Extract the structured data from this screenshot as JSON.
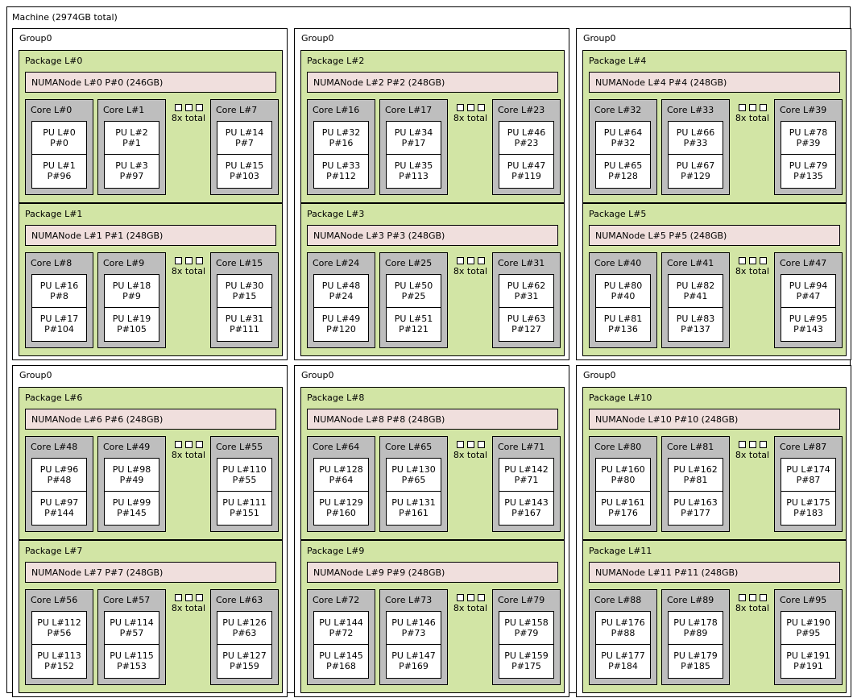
{
  "machine": {
    "label": "Machine (2974GB total)"
  },
  "groups": [
    {
      "label": "Group0",
      "packages": [
        {
          "label": "Package L#0",
          "numa": "NUMANode L#0 P#0 (246GB)",
          "more": "8x total",
          "cores": [
            {
              "label": "Core L#0",
              "pus": [
                {
                  "l": "PU L#0",
                  "p": "P#0"
                },
                {
                  "l": "PU L#1",
                  "p": "P#96"
                }
              ]
            },
            {
              "label": "Core L#1",
              "pus": [
                {
                  "l": "PU L#2",
                  "p": "P#1"
                },
                {
                  "l": "PU L#3",
                  "p": "P#97"
                }
              ]
            },
            {
              "label": "Core L#7",
              "pus": [
                {
                  "l": "PU L#14",
                  "p": "P#7"
                },
                {
                  "l": "PU L#15",
                  "p": "P#103"
                }
              ]
            }
          ]
        },
        {
          "label": "Package L#1",
          "numa": "NUMANode L#1 P#1 (248GB)",
          "more": "8x total",
          "cores": [
            {
              "label": "Core L#8",
              "pus": [
                {
                  "l": "PU L#16",
                  "p": "P#8"
                },
                {
                  "l": "PU L#17",
                  "p": "P#104"
                }
              ]
            },
            {
              "label": "Core L#9",
              "pus": [
                {
                  "l": "PU L#18",
                  "p": "P#9"
                },
                {
                  "l": "PU L#19",
                  "p": "P#105"
                }
              ]
            },
            {
              "label": "Core L#15",
              "pus": [
                {
                  "l": "PU L#30",
                  "p": "P#15"
                },
                {
                  "l": "PU L#31",
                  "p": "P#111"
                }
              ]
            }
          ]
        }
      ]
    },
    {
      "label": "Group0",
      "packages": [
        {
          "label": "Package L#2",
          "numa": "NUMANode L#2 P#2 (248GB)",
          "more": "8x total",
          "cores": [
            {
              "label": "Core L#16",
              "pus": [
                {
                  "l": "PU L#32",
                  "p": "P#16"
                },
                {
                  "l": "PU L#33",
                  "p": "P#112"
                }
              ]
            },
            {
              "label": "Core L#17",
              "pus": [
                {
                  "l": "PU L#34",
                  "p": "P#17"
                },
                {
                  "l": "PU L#35",
                  "p": "P#113"
                }
              ]
            },
            {
              "label": "Core L#23",
              "pus": [
                {
                  "l": "PU L#46",
                  "p": "P#23"
                },
                {
                  "l": "PU L#47",
                  "p": "P#119"
                }
              ]
            }
          ]
        },
        {
          "label": "Package L#3",
          "numa": "NUMANode L#3 P#3 (248GB)",
          "more": "8x total",
          "cores": [
            {
              "label": "Core L#24",
              "pus": [
                {
                  "l": "PU L#48",
                  "p": "P#24"
                },
                {
                  "l": "PU L#49",
                  "p": "P#120"
                }
              ]
            },
            {
              "label": "Core L#25",
              "pus": [
                {
                  "l": "PU L#50",
                  "p": "P#25"
                },
                {
                  "l": "PU L#51",
                  "p": "P#121"
                }
              ]
            },
            {
              "label": "Core L#31",
              "pus": [
                {
                  "l": "PU L#62",
                  "p": "P#31"
                },
                {
                  "l": "PU L#63",
                  "p": "P#127"
                }
              ]
            }
          ]
        }
      ]
    },
    {
      "label": "Group0",
      "packages": [
        {
          "label": "Package L#4",
          "numa": "NUMANode L#4 P#4 (248GB)",
          "more": "8x total",
          "cores": [
            {
              "label": "Core L#32",
              "pus": [
                {
                  "l": "PU L#64",
                  "p": "P#32"
                },
                {
                  "l": "PU L#65",
                  "p": "P#128"
                }
              ]
            },
            {
              "label": "Core L#33",
              "pus": [
                {
                  "l": "PU L#66",
                  "p": "P#33"
                },
                {
                  "l": "PU L#67",
                  "p": "P#129"
                }
              ]
            },
            {
              "label": "Core L#39",
              "pus": [
                {
                  "l": "PU L#78",
                  "p": "P#39"
                },
                {
                  "l": "PU L#79",
                  "p": "P#135"
                }
              ]
            }
          ]
        },
        {
          "label": "Package L#5",
          "numa": "NUMANode L#5 P#5 (248GB)",
          "more": "8x total",
          "cores": [
            {
              "label": "Core L#40",
              "pus": [
                {
                  "l": "PU L#80",
                  "p": "P#40"
                },
                {
                  "l": "PU L#81",
                  "p": "P#136"
                }
              ]
            },
            {
              "label": "Core L#41",
              "pus": [
                {
                  "l": "PU L#82",
                  "p": "P#41"
                },
                {
                  "l": "PU L#83",
                  "p": "P#137"
                }
              ]
            },
            {
              "label": "Core L#47",
              "pus": [
                {
                  "l": "PU L#94",
                  "p": "P#47"
                },
                {
                  "l": "PU L#95",
                  "p": "P#143"
                }
              ]
            }
          ]
        }
      ]
    },
    {
      "label": "Group0",
      "packages": [
        {
          "label": "Package L#6",
          "numa": "NUMANode L#6 P#6 (248GB)",
          "more": "8x total",
          "cores": [
            {
              "label": "Core L#48",
              "pus": [
                {
                  "l": "PU L#96",
                  "p": "P#48"
                },
                {
                  "l": "PU L#97",
                  "p": "P#144"
                }
              ]
            },
            {
              "label": "Core L#49",
              "pus": [
                {
                  "l": "PU L#98",
                  "p": "P#49"
                },
                {
                  "l": "PU L#99",
                  "p": "P#145"
                }
              ]
            },
            {
              "label": "Core L#55",
              "pus": [
                {
                  "l": "PU L#110",
                  "p": "P#55"
                },
                {
                  "l": "PU L#111",
                  "p": "P#151"
                }
              ]
            }
          ]
        },
        {
          "label": "Package L#7",
          "numa": "NUMANode L#7 P#7 (248GB)",
          "more": "8x total",
          "cores": [
            {
              "label": "Core L#56",
              "pus": [
                {
                  "l": "PU L#112",
                  "p": "P#56"
                },
                {
                  "l": "PU L#113",
                  "p": "P#152"
                }
              ]
            },
            {
              "label": "Core L#57",
              "pus": [
                {
                  "l": "PU L#114",
                  "p": "P#57"
                },
                {
                  "l": "PU L#115",
                  "p": "P#153"
                }
              ]
            },
            {
              "label": "Core L#63",
              "pus": [
                {
                  "l": "PU L#126",
                  "p": "P#63"
                },
                {
                  "l": "PU L#127",
                  "p": "P#159"
                }
              ]
            }
          ]
        }
      ]
    },
    {
      "label": "Group0",
      "packages": [
        {
          "label": "Package L#8",
          "numa": "NUMANode L#8 P#8 (248GB)",
          "more": "8x total",
          "cores": [
            {
              "label": "Core L#64",
              "pus": [
                {
                  "l": "PU L#128",
                  "p": "P#64"
                },
                {
                  "l": "PU L#129",
                  "p": "P#160"
                }
              ]
            },
            {
              "label": "Core L#65",
              "pus": [
                {
                  "l": "PU L#130",
                  "p": "P#65"
                },
                {
                  "l": "PU L#131",
                  "p": "P#161"
                }
              ]
            },
            {
              "label": "Core L#71",
              "pus": [
                {
                  "l": "PU L#142",
                  "p": "P#71"
                },
                {
                  "l": "PU L#143",
                  "p": "P#167"
                }
              ]
            }
          ]
        },
        {
          "label": "Package L#9",
          "numa": "NUMANode L#9 P#9 (248GB)",
          "more": "8x total",
          "cores": [
            {
              "label": "Core L#72",
              "pus": [
                {
                  "l": "PU L#144",
                  "p": "P#72"
                },
                {
                  "l": "PU L#145",
                  "p": "P#168"
                }
              ]
            },
            {
              "label": "Core L#73",
              "pus": [
                {
                  "l": "PU L#146",
                  "p": "P#73"
                },
                {
                  "l": "PU L#147",
                  "p": "P#169"
                }
              ]
            },
            {
              "label": "Core L#79",
              "pus": [
                {
                  "l": "PU L#158",
                  "p": "P#79"
                },
                {
                  "l": "PU L#159",
                  "p": "P#175"
                }
              ]
            }
          ]
        }
      ]
    },
    {
      "label": "Group0",
      "packages": [
        {
          "label": "Package L#10",
          "numa": "NUMANode L#10 P#10 (248GB)",
          "more": "8x total",
          "cores": [
            {
              "label": "Core L#80",
              "pus": [
                {
                  "l": "PU L#160",
                  "p": "P#80"
                },
                {
                  "l": "PU L#161",
                  "p": "P#176"
                }
              ]
            },
            {
              "label": "Core L#81",
              "pus": [
                {
                  "l": "PU L#162",
                  "p": "P#81"
                },
                {
                  "l": "PU L#163",
                  "p": "P#177"
                }
              ]
            },
            {
              "label": "Core L#87",
              "pus": [
                {
                  "l": "PU L#174",
                  "p": "P#87"
                },
                {
                  "l": "PU L#175",
                  "p": "P#183"
                }
              ]
            }
          ]
        },
        {
          "label": "Package L#11",
          "numa": "NUMANode L#11 P#11 (248GB)",
          "more": "8x total",
          "cores": [
            {
              "label": "Core L#88",
              "pus": [
                {
                  "l": "PU L#176",
                  "p": "P#88"
                },
                {
                  "l": "PU L#177",
                  "p": "P#184"
                }
              ]
            },
            {
              "label": "Core L#89",
              "pus": [
                {
                  "l": "PU L#178",
                  "p": "P#89"
                },
                {
                  "l": "PU L#179",
                  "p": "P#185"
                }
              ]
            },
            {
              "label": "Core L#95",
              "pus": [
                {
                  "l": "PU L#190",
                  "p": "P#95"
                },
                {
                  "l": "PU L#191",
                  "p": "P#191"
                }
              ]
            }
          ]
        }
      ]
    }
  ]
}
